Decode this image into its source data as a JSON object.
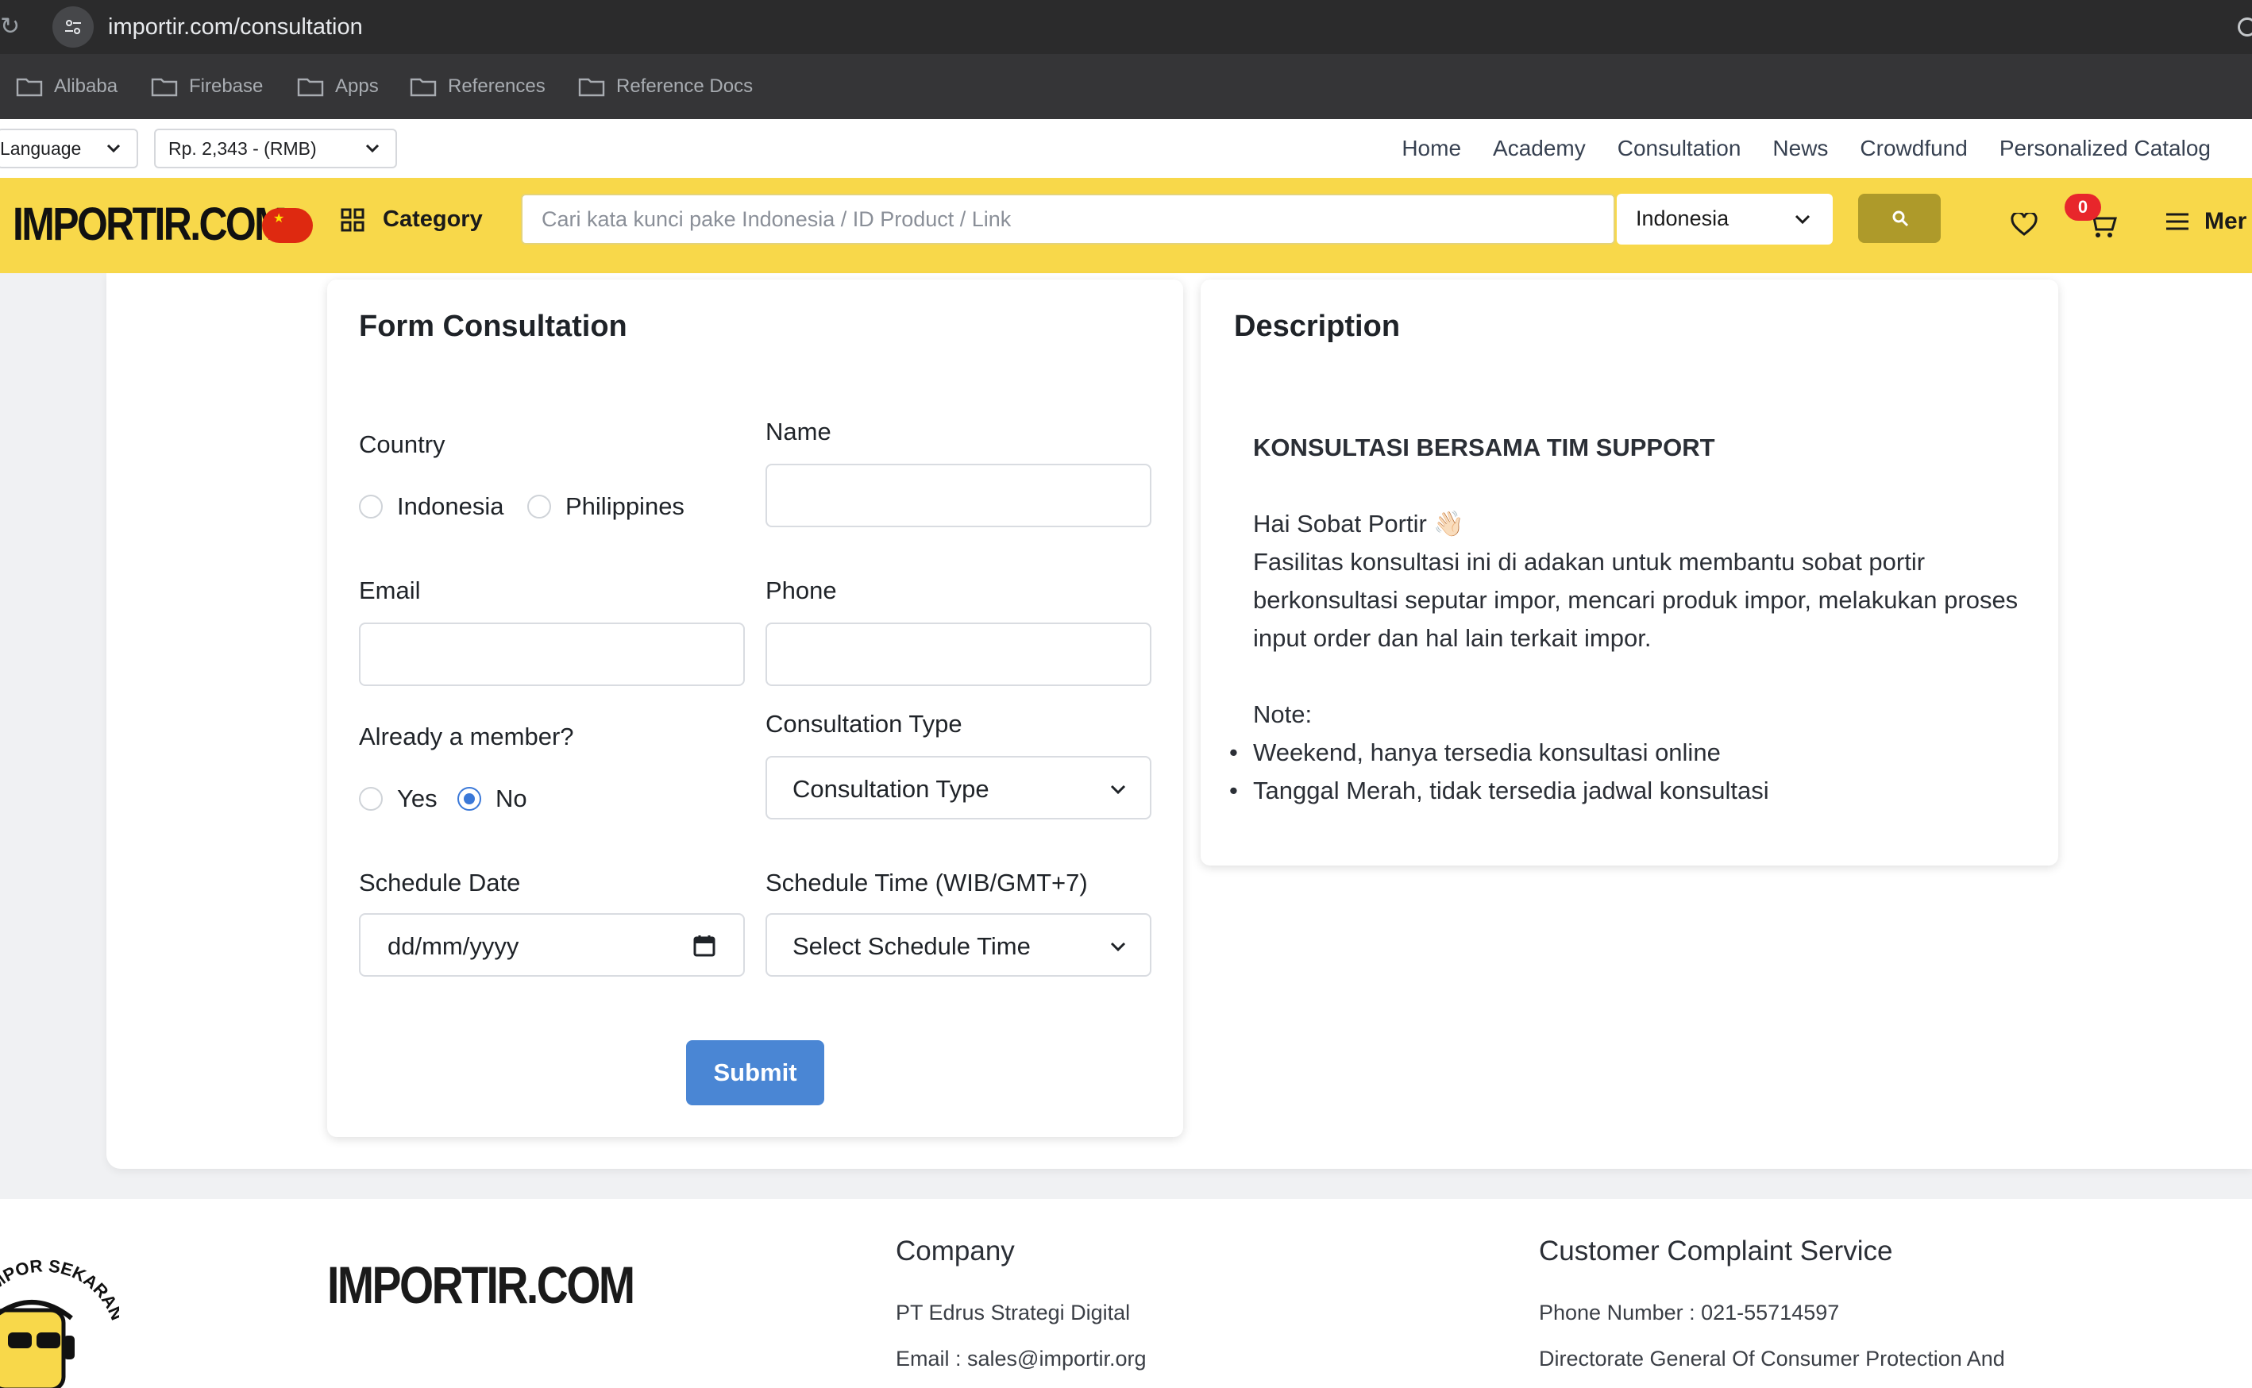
{
  "browser": {
    "url": "importir.com/consultation",
    "bookmarks": [
      "Alibaba",
      "Firebase",
      "Apps",
      "References",
      "Reference Docs"
    ]
  },
  "topnav": {
    "language_label": "Language",
    "currency_label": "Rp. 2,343 - (RMB)",
    "links": [
      "Home",
      "Academy",
      "Consultation",
      "News",
      "Crowdfund",
      "Personalized Catalog"
    ]
  },
  "header": {
    "logo": "IMPORTIR.COM",
    "category_label": "Category",
    "search_placeholder": "Cari kata kunci pake Indonesia / ID Product / Link",
    "search_language": "Indonesia",
    "cart_count": "0",
    "menu_label": "Mer"
  },
  "form": {
    "title": "Form Consultation",
    "country_label": "Country",
    "country_options": [
      "Indonesia",
      "Philippines"
    ],
    "name_label": "Name",
    "email_label": "Email",
    "phone_label": "Phone",
    "member_label": "Already a member?",
    "member_options": [
      "Yes",
      "No"
    ],
    "member_selected": "No",
    "consultation_type_label": "Consultation Type",
    "consultation_type_value": "Consultation Type",
    "schedule_date_label": "Schedule Date",
    "schedule_date_placeholder": "dd/mm/yyyy",
    "schedule_time_label": "Schedule Time (WIB/GMT+7)",
    "schedule_time_value": "Select Schedule Time",
    "submit_label": "Submit"
  },
  "description": {
    "title": "Description",
    "heading": "KONSULTASI BERSAMA TIM SUPPORT",
    "greeting": "Hai Sobat Portir 👋🏻",
    "body": "Fasilitas konsultasi ini di adakan untuk membantu sobat portir berkonsultasi seputar impor, mencari produk impor, melakukan proses input order dan hal lain terkait impor.",
    "note_label": "Note:",
    "notes": [
      "Weekend, hanya tersedia konsultasi online",
      "Tanggal Merah, tidak tersedia jadwal konsultasi"
    ]
  },
  "footer": {
    "mascot_text": "IMPOR SEKARANG!",
    "logo": "IMPORTIR.COM",
    "company_title": "Company",
    "company_name": "PT Edrus Strategi Digital",
    "company_email": "Email : sales@importir.org",
    "complaint_title": "Customer Complaint Service",
    "complaint_phone": "Phone Number : 021-55714597",
    "complaint_directorate": "Directorate General Of Consumer Protection And"
  },
  "colors": {
    "header_yellow": "#f8d84a",
    "search_button": "#ae9a2a",
    "submit_blue": "#4a86d4",
    "badge_red": "#e8262b"
  }
}
